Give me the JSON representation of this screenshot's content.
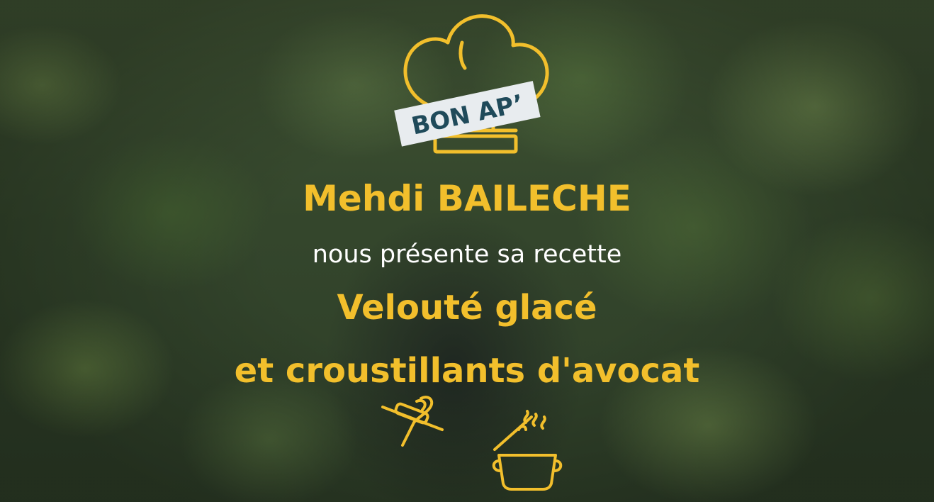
{
  "logo": {
    "label": "BON AP’",
    "icon": "chef-hat-icon"
  },
  "chef_name": "Mehdi BAILECHE",
  "subtitle": "nous présente sa recette",
  "recipe": {
    "line1": "Velouté glacé",
    "line2": "et croustillants d'avocat"
  },
  "icons": [
    "whisk-rolling-pin-icon",
    "cooking-pot-icon"
  ],
  "colors": {
    "accent": "#f2bf2c",
    "text_white": "#ffffff",
    "banner_bg": "#e8ecef",
    "banner_text": "#1f4a5a"
  }
}
